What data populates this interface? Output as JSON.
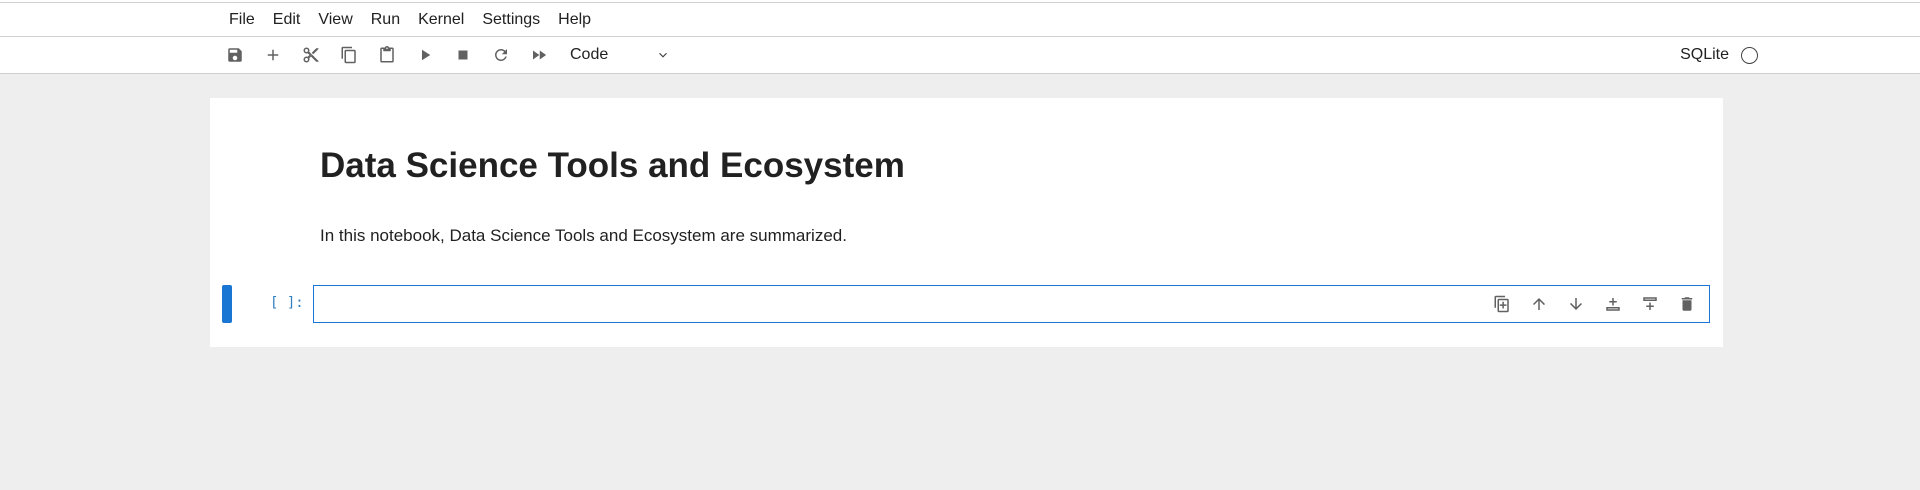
{
  "menu": [
    "File",
    "Edit",
    "View",
    "Run",
    "Kernel",
    "Settings",
    "Help"
  ],
  "toolbar": {
    "buttons": [
      "save-icon",
      "add-cell-icon",
      "cut-icon",
      "copy-icon",
      "paste-icon",
      "run-icon",
      "stop-icon",
      "restart-icon",
      "fast-forward-icon"
    ],
    "cell_type": "Code",
    "kernel_name": "SQLite"
  },
  "notebook": {
    "heading": "Data Science Tools and Ecosystem",
    "intro": "In this notebook, Data Science Tools and Ecosystem are summarized.",
    "cell_prompt": "[ ]:",
    "cell_tools": [
      "duplicate-icon",
      "move-up-icon",
      "move-down-icon",
      "insert-above-icon",
      "insert-below-icon",
      "delete-icon"
    ]
  },
  "colors": {
    "accent": "#1976d2",
    "background": "#eeeeee",
    "prompt": "#307fc1"
  }
}
